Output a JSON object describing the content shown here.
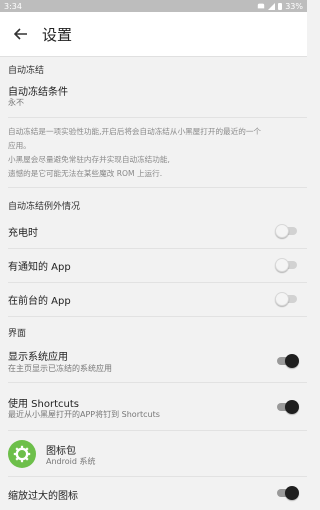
{
  "status_bar": {
    "time": "3:34",
    "battery": "33%"
  },
  "app_bar": {
    "back_icon": "arrow-left-icon",
    "title": "设置"
  },
  "auto_freeze": {
    "header": "自动冻结",
    "condition": {
      "title": "自动冻结条件",
      "value": "永不"
    },
    "description": [
      "自动冻结是一项实验性功能,开启后将会自动冻结从小黑屋打开的最近的一个",
      "应用。",
      "小黑屋会尽量避免常驻内存并实现自动冻结功能,",
      "遗憾的是它可能无法在某些魔改 ROM 上运行."
    ]
  },
  "exceptions": {
    "header": "自动冻结例外情况",
    "items": [
      {
        "label": "充电时",
        "on": false
      },
      {
        "label": "有通知的 App",
        "on": false
      },
      {
        "label": "在前台的 App",
        "on": false
      }
    ]
  },
  "interface": {
    "header": "界面",
    "show_system": {
      "title": "显示系统应用",
      "subtitle": "在主页显示已冻结的系统应用",
      "on": true
    },
    "shortcuts": {
      "title": "使用 Shortcuts",
      "subtitle": "最近从小黑屋打开的APP将钉到 Shortcuts",
      "on": true
    },
    "icon_pack": {
      "title": "图标包",
      "subtitle": "Android 系统",
      "icon": "gear-icon",
      "icon_color": "#6dbf4a"
    },
    "scale_icons": {
      "title": "缩放过大的图标",
      "on": true
    }
  }
}
